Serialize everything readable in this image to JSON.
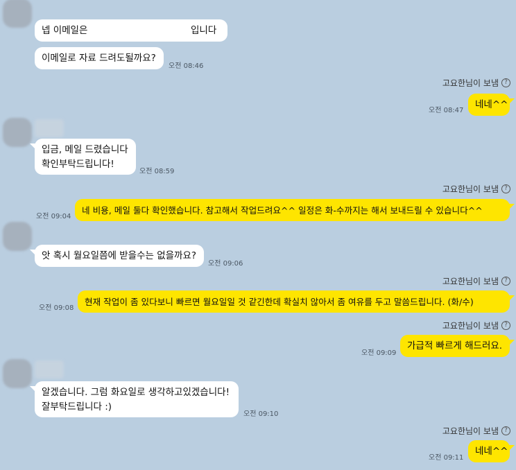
{
  "messages": [
    {
      "id": "m1",
      "text_before": "넵 이메일은",
      "text_after": "입니다",
      "time": ""
    },
    {
      "id": "m2",
      "text": "이메일로 자료 드려도될까요?",
      "time": "오전 08:46"
    },
    {
      "id": "m3",
      "text": "네네^^",
      "time": "오전 08:47",
      "sender": "고요한님이 보냄"
    },
    {
      "id": "m4",
      "line1": "입금, 메일 드렸습니다",
      "line2": "확인부탁드립니다!",
      "time": "오전 08:59"
    },
    {
      "id": "m5",
      "text": "네 비용, 메일 둘다 확인했습니다. 참고해서 작업드려요^^ 일정은 화-수까지는 해서 보내드릴 수 있습니다^^",
      "time": "오전 09:04",
      "sender": "고요한님이 보냄"
    },
    {
      "id": "m6",
      "text": "앗 혹시 월요일쯤에 받을수는 없을까요?",
      "time": "오전 09:06"
    },
    {
      "id": "m7",
      "text": "현재 작업이 좀 있다보니 빠르면 월요일일 것 같긴한데 확실치 않아서 좀 여유를 두고 말씀드립니다. (화/수)",
      "time": "오전 09:08",
      "sender": "고요한님이 보냄"
    },
    {
      "id": "m8",
      "text": "가급적 빠르게 해드러요.",
      "time": "오전 09:09",
      "sender": "고요한님이 보냄"
    },
    {
      "id": "m9",
      "line1": "알겠습니다. 그럼 화요일로 생각하고있겠습니다!",
      "line2": "잘부탁드립니다 :)",
      "time": "오전 09:10"
    },
    {
      "id": "m10",
      "text": "네네^^",
      "time": "오전 09:11",
      "sender": "고요한님이 보냄"
    }
  ],
  "icons": {
    "help": "question-circle-icon"
  }
}
